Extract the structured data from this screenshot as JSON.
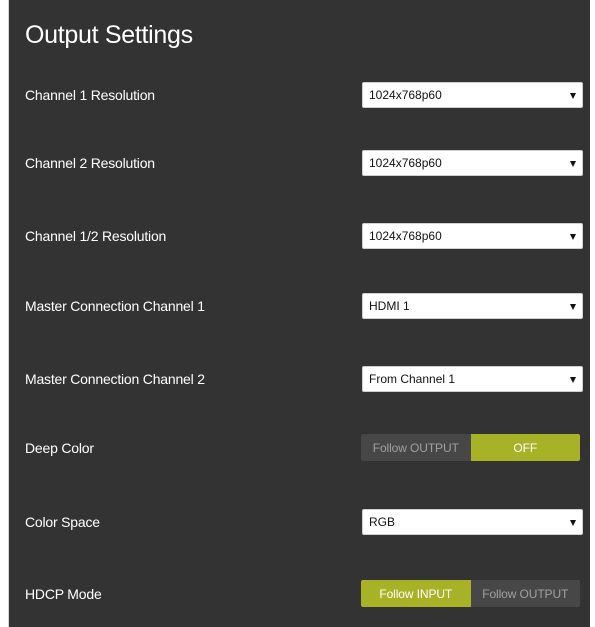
{
  "page": {
    "title": "Output Settings"
  },
  "settings": [
    {
      "label": "Channel 1 Resolution",
      "value": "1024x768p60"
    },
    {
      "label": "Channel 2 Resolution",
      "value": "1024x768p60"
    },
    {
      "label": "Channel 1/2 Resolution",
      "value": "1024x768p60"
    },
    {
      "label": "Master Connection Channel 1",
      "value": "HDMI 1"
    },
    {
      "label": "Master Connection Channel 2",
      "value": "From Channel 1"
    },
    {
      "label": "Deep Color",
      "options": [
        "Follow OUTPUT",
        "OFF"
      ],
      "selected": "OFF"
    },
    {
      "label": "Color Space",
      "value": "RGB"
    },
    {
      "label": "HDCP Mode",
      "options": [
        "Follow INPUT",
        "Follow OUTPUT"
      ],
      "selected": "Follow INPUT"
    }
  ],
  "theme": {
    "panel_background": "#333333",
    "accent": "#a8b227",
    "inactive_segment": "#474747"
  },
  "icons": {
    "dropdown": "chevron-down-icon"
  }
}
